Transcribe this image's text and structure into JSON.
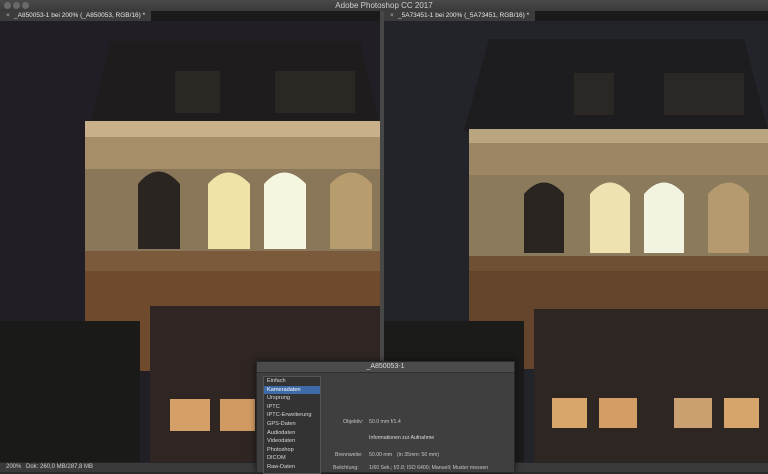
{
  "app": {
    "title": "Adobe Photoshop CC 2017"
  },
  "documents": [
    {
      "tab_label": "_A850053-1 bei 200% (_A850053, RGB/16) *"
    },
    {
      "tab_label": "_5A73451-1 bei 200% (_5A73451, RGB/16) *"
    }
  ],
  "status": {
    "zoom": "200%",
    "doc_size": "Dok: 260,0 MB/287,8 MB"
  },
  "dialog": {
    "title": "_A850053-1",
    "sidebar_items": [
      "Einfach",
      "Kameradaten",
      "Ursprung",
      "IPTC",
      "IPTC-Erweiterung",
      "GPS-Daten",
      "Audiodaten",
      "Videodaten",
      "Photoshop",
      "DICOM",
      "Raw-Daten"
    ],
    "selected_index": 1,
    "fields": {
      "objektiv_label": "Objektiv:",
      "objektiv_value": "50.0 mm f/1.4",
      "section": "Informationen zur Aufnahme",
      "brennweite_label": "Brennweite:",
      "brennweite_value": "50.00 mm",
      "brennweite_35": "(in 35mm: 50 mm)",
      "belichtung_label": "Belichtung:",
      "belichtung_value": "1/60 Sek.;  f/2.8;  ISO 6400;  Manuell;  Muster messen"
    }
  },
  "colors": {
    "sky": "#232028",
    "stone": "#8f7c5f",
    "brick": "#6e4a2a",
    "window": "#f3e6a8",
    "lit": "#e8c48a",
    "selected": "#3f6aa8"
  }
}
